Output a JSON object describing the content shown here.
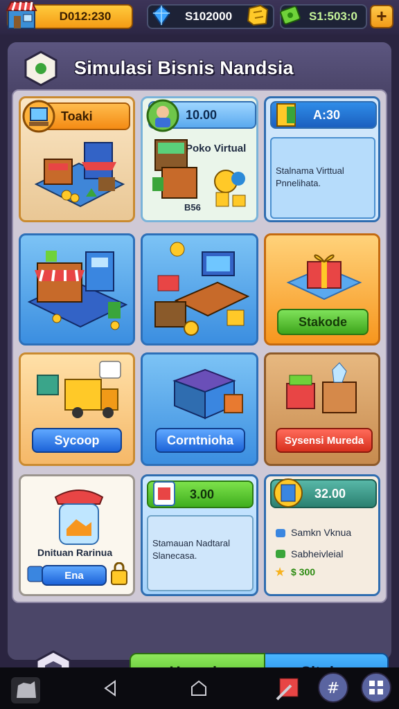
{
  "top_bar": {
    "shop_value": "D012:230",
    "gem_value": "S102000",
    "cash_value": "S1:503:0",
    "plus_label": "+"
  },
  "panel": {
    "title": "Simulasi Bisnis Nandsia"
  },
  "cards": {
    "toko": {
      "tag": "Toaki"
    },
    "virtual": {
      "tag": "10.00",
      "title": "Poko Virtual",
      "sub": "B56"
    },
    "info_time": {
      "tag": "A:30",
      "text": "Stalnama Virttual Pnnelihata."
    },
    "gift": {
      "button": "Stakode"
    },
    "delivery": {
      "button": "Sycoop"
    },
    "storage": {
      "button": "Corntnioha"
    },
    "boxes": {
      "button": "Sysensi Mureda"
    },
    "jar": {
      "caption": "Dnituan Rarinua",
      "button": "Ena"
    },
    "green_info": {
      "tag": "3.00",
      "text": "Stamauan Nadtaral Slanecasa."
    },
    "teal_info": {
      "tag": "32.00",
      "line1": "Samkn Vknua",
      "line2": "Sabheivleial",
      "line3": "$ 300"
    }
  },
  "bottom": {
    "left_button": "Upoade",
    "right_button": "Situine"
  },
  "colors": {
    "accent_orange": "#f49b14",
    "accent_blue": "#2d6fb8",
    "accent_green": "#3fae1e"
  }
}
